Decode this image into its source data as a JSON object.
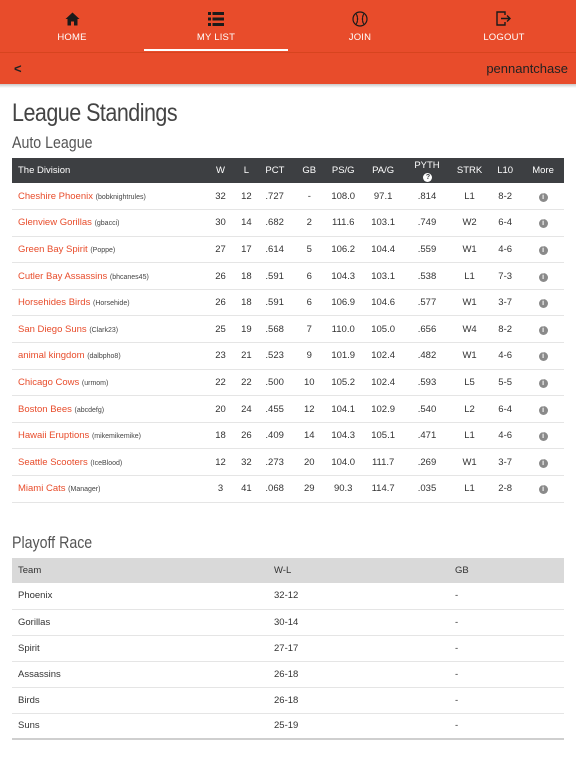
{
  "nav": {
    "items": [
      {
        "label": "HOME",
        "icon": "home-icon"
      },
      {
        "label": "MY LIST",
        "icon": "list-icon",
        "active": true
      },
      {
        "label": "JOIN",
        "icon": "baseball-icon"
      },
      {
        "label": "LOGOUT",
        "icon": "logout-icon"
      }
    ]
  },
  "subnav": {
    "back": "<",
    "brand": "pennantchase"
  },
  "page": {
    "title": "League Standings",
    "league": "Auto League"
  },
  "colors": {
    "accent": "#e84c2b",
    "header_dark": "#3d3f42"
  },
  "standings": {
    "columns": [
      "The Division",
      "W",
      "L",
      "PCT",
      "GB",
      "PS/G",
      "PA/G",
      "PYTH",
      "STRK",
      "L10",
      "More"
    ],
    "rows": [
      {
        "team": "Cheshire Phoenix",
        "owner": "(bobknightrules)",
        "w": "32",
        "l": "12",
        "pct": ".727",
        "gb": "-",
        "psg": "108.0",
        "pag": "97.1",
        "pyth": ".814",
        "strk": "L1",
        "l10": "8-2"
      },
      {
        "team": "Glenview Gorillas",
        "owner": "(gbacci)",
        "w": "30",
        "l": "14",
        "pct": ".682",
        "gb": "2",
        "psg": "111.6",
        "pag": "103.1",
        "pyth": ".749",
        "strk": "W2",
        "l10": "6-4"
      },
      {
        "team": "Green Bay Spirit",
        "owner": "(Poppe)",
        "w": "27",
        "l": "17",
        "pct": ".614",
        "gb": "5",
        "psg": "106.2",
        "pag": "104.4",
        "pyth": ".559",
        "strk": "W1",
        "l10": "4-6"
      },
      {
        "team": "Cutler Bay Assassins",
        "owner": "(bhcanes45)",
        "w": "26",
        "l": "18",
        "pct": ".591",
        "gb": "6",
        "psg": "104.3",
        "pag": "103.1",
        "pyth": ".538",
        "strk": "L1",
        "l10": "7-3"
      },
      {
        "team": "Horsehides Birds",
        "owner": "(Horsehide)",
        "w": "26",
        "l": "18",
        "pct": ".591",
        "gb": "6",
        "psg": "106.9",
        "pag": "104.6",
        "pyth": ".577",
        "strk": "W1",
        "l10": "3-7"
      },
      {
        "team": "San Diego Suns",
        "owner": "(Clark23)",
        "w": "25",
        "l": "19",
        "pct": ".568",
        "gb": "7",
        "psg": "110.0",
        "pag": "105.0",
        "pyth": ".656",
        "strk": "W4",
        "l10": "8-2"
      },
      {
        "team": "animal kingdom",
        "owner": "(dalbpho8)",
        "w": "23",
        "l": "21",
        "pct": ".523",
        "gb": "9",
        "psg": "101.9",
        "pag": "102.4",
        "pyth": ".482",
        "strk": "W1",
        "l10": "4-6"
      },
      {
        "team": "Chicago Cows",
        "owner": "(urmom)",
        "w": "22",
        "l": "22",
        "pct": ".500",
        "gb": "10",
        "psg": "105.2",
        "pag": "102.4",
        "pyth": ".593",
        "strk": "L5",
        "l10": "5-5"
      },
      {
        "team": "Boston Bees",
        "owner": "(abcdefg)",
        "w": "20",
        "l": "24",
        "pct": ".455",
        "gb": "12",
        "psg": "104.1",
        "pag": "102.9",
        "pyth": ".540",
        "strk": "L2",
        "l10": "6-4"
      },
      {
        "team": "Hawaii Eruptions",
        "owner": "(mikemikemike)",
        "w": "18",
        "l": "26",
        "pct": ".409",
        "gb": "14",
        "psg": "104.3",
        "pag": "105.1",
        "pyth": ".471",
        "strk": "L1",
        "l10": "4-6"
      },
      {
        "team": "Seattle Scooters",
        "owner": "(IceBlood)",
        "w": "12",
        "l": "32",
        "pct": ".273",
        "gb": "20",
        "psg": "104.0",
        "pag": "111.7",
        "pyth": ".269",
        "strk": "W1",
        "l10": "3-7"
      },
      {
        "team": "Miami Cats",
        "owner": "(Manager)",
        "w": "3",
        "l": "41",
        "pct": ".068",
        "gb": "29",
        "psg": "90.3",
        "pag": "114.7",
        "pyth": ".035",
        "strk": "L1",
        "l10": "2-8"
      }
    ]
  },
  "playoff": {
    "title": "Playoff Race",
    "columns": [
      "Team",
      "W-L",
      "GB"
    ],
    "rows": [
      {
        "team": "Phoenix",
        "wl": "32-12",
        "gb": "-"
      },
      {
        "team": "Gorillas",
        "wl": "30-14",
        "gb": "-"
      },
      {
        "team": "Spirit",
        "wl": "27-17",
        "gb": "-"
      },
      {
        "team": "Assassins",
        "wl": "26-18",
        "gb": "-"
      },
      {
        "team": "Birds",
        "wl": "26-18",
        "gb": "-"
      },
      {
        "team": "Suns",
        "wl": "25-19",
        "gb": "-"
      }
    ]
  }
}
